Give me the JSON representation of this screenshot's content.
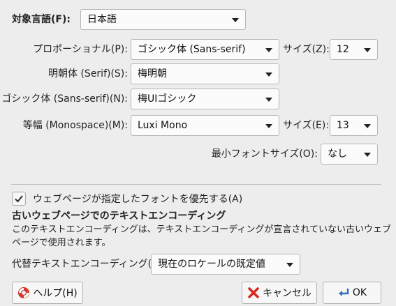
{
  "target_language": {
    "label": "対象言語(F):",
    "value": "日本語"
  },
  "proportional": {
    "label": "プロポーショナル(P):",
    "value": "ゴシック体 (Sans-serif)",
    "size_label": "サイズ(Z):",
    "size_value": "12"
  },
  "serif": {
    "label": "明朝体 (Serif)(S):",
    "value": "梅明朝"
  },
  "sans_serif": {
    "label": "ゴシック体 (Sans-serif)(N):",
    "value": "梅UIゴシック"
  },
  "monospace": {
    "label": "等幅 (Monospace)(M):",
    "value": "Luxi Mono",
    "size_label": "サイズ(E):",
    "size_value": "13"
  },
  "min_font_size": {
    "label": "最小フォントサイズ(O):",
    "value": "なし"
  },
  "allow_page_fonts": {
    "label": "ウェブページが指定したフォントを優先する(A)",
    "checked": true
  },
  "encoding": {
    "heading": "古いウェブページでのテキストエンコーディング",
    "description_line1": "このテキストエンコーディングは、テキストエンコーディングが宣言されていない古いウェブ",
    "description_line2": "ページで使用されます。",
    "fallback_label": "代替テキストエンコーディング(T):",
    "fallback_value": "現在のロケールの既定値"
  },
  "buttons": {
    "help": "ヘルプ(H)",
    "cancel": "キャンセル",
    "ok": "OK"
  }
}
